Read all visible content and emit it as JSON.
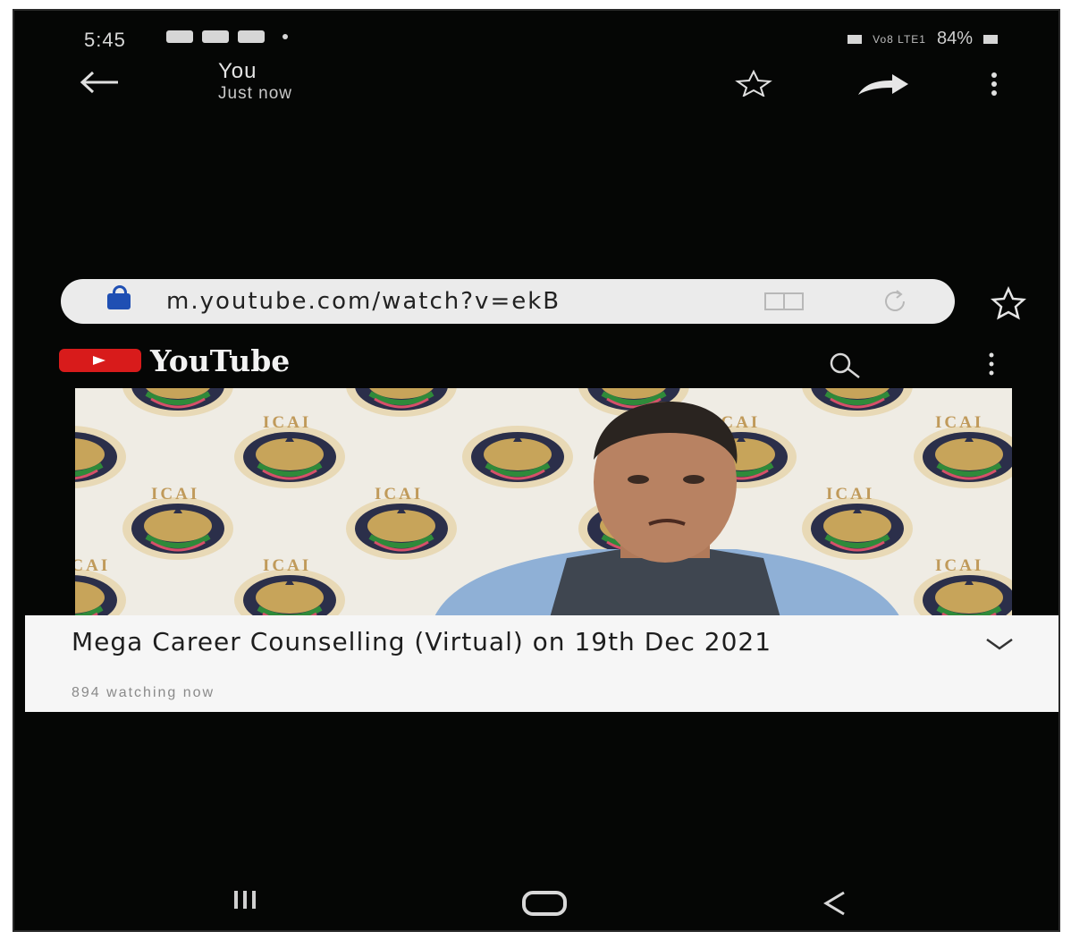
{
  "status_bar": {
    "time": "5:45",
    "network": "Vo8 LTE1",
    "battery": "84%"
  },
  "header": {
    "title": "You",
    "subtitle": "Just now"
  },
  "browser": {
    "url": "m.youtube.com/watch?v=ekB"
  },
  "youtube": {
    "brand": "YouTube",
    "watermark_text": "ICAI",
    "video_title": "Mega Career Counselling (Virtual) on 19th Dec 2021",
    "viewers": "894 watching now"
  },
  "colors": {
    "youtube_red": "#d81b1b",
    "lock_blue": "#1f4fb3",
    "background": "#050605"
  },
  "icons": [
    "back-arrow-icon",
    "star-icon",
    "share-icon",
    "more-vertical-icon",
    "lock-icon",
    "reader-mode-icon",
    "reload-icon",
    "search-icon",
    "chevron-down-icon",
    "recent-apps-icon",
    "home-icon",
    "nav-back-icon"
  ]
}
